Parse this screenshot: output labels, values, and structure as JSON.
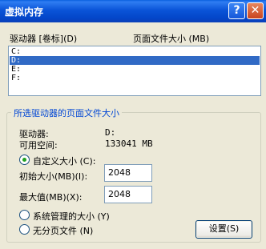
{
  "window": {
    "title": "虚拟内存",
    "help_glyph": "?",
    "close_glyph": "✕"
  },
  "list": {
    "col_drive": "驱动器 [卷标](D)",
    "col_size": "页面文件大小 (MB)",
    "rows": [
      "C:",
      "D:",
      "E:",
      "F:"
    ],
    "selected_index": 1
  },
  "group": {
    "legend": "所选驱动器的页面文件大小",
    "drive_label": "驱动器:",
    "drive_value": "D:",
    "space_label": "可用空间:",
    "space_value": "133041 MB",
    "custom_label": "自定义大小 (C):",
    "initial_label": "初始大小(MB)(I):",
    "initial_value": "2048",
    "max_label": "最大值(MB)(X):",
    "max_value": "2048",
    "system_label": "系统管理的大小 (Y)",
    "nopage_label": "无分页文件 (N)",
    "set_button": "设置(S)",
    "selected_option": "custom"
  },
  "colors": {
    "title_bar": "#0a54d8",
    "selection": "#316ac5",
    "legend": "#0046d5"
  }
}
